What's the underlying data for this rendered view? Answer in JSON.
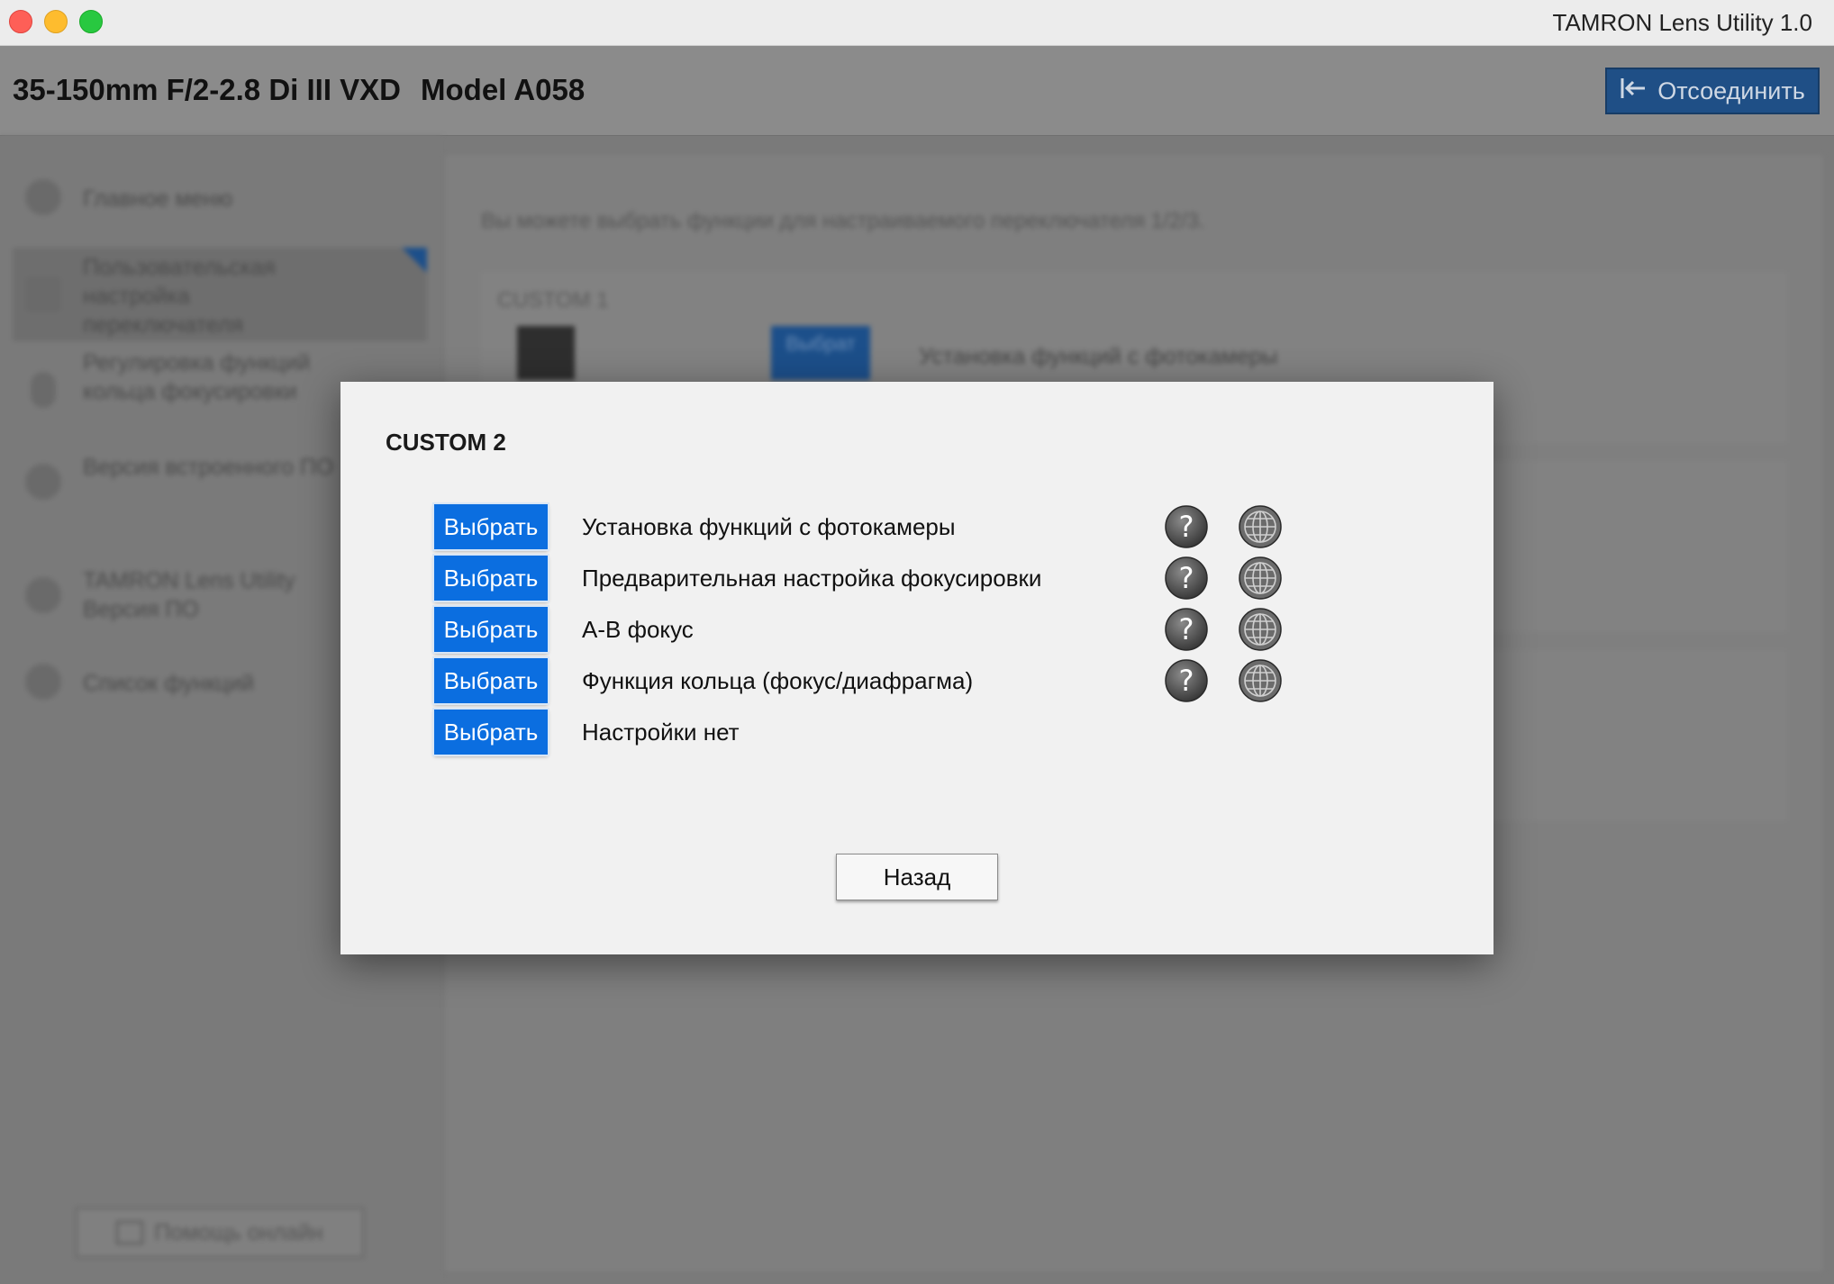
{
  "window": {
    "app_title": "TAMRON Lens Utility   1.0"
  },
  "header": {
    "lens_name": "35-150mm F/2-2.8 Di III VXD",
    "model": "Model A058",
    "disconnect_label": "Отсоединить"
  },
  "sidebar": {
    "items": [
      {
        "label": "Главное меню",
        "icon": "home-icon"
      },
      {
        "label": "Пользовательская настройка переключателя",
        "icon": "switch-icon",
        "active": true
      },
      {
        "label": "Регулировка функций кольца фокусировки",
        "icon": "ring-icon"
      },
      {
        "label": "Версия встроенного ПО",
        "icon": "firmware-icon"
      },
      {
        "label": "TAMRON Lens Utility Версия ПО",
        "icon": "info-icon"
      },
      {
        "label": "Список функций",
        "icon": "help-icon"
      }
    ],
    "online_help_label": "Помощь онлайн"
  },
  "content": {
    "note": "Вы можете выбрать функции для настраиваемого переключателя 1/2/3.",
    "cards": [
      {
        "title": "CUSTOM 1",
        "select_label": "Выбрат",
        "description": "Установка функций с фотокамеры"
      },
      {
        "title": "",
        "select_label": "",
        "description": ""
      },
      {
        "title": "",
        "select_label": "",
        "description": ""
      }
    ]
  },
  "modal": {
    "title": "CUSTOM 2",
    "options": [
      {
        "button": "Выбрать",
        "label": "Установка функций с фотокамеры",
        "has_help": true
      },
      {
        "button": "Выбрать",
        "label": "Предварительная настройка фокусировки",
        "has_help": true
      },
      {
        "button": "Выбрать",
        "label": "A-B фокус",
        "has_help": true
      },
      {
        "button": "Выбрать",
        "label": "Функция кольца (фокус/диафрагма)",
        "has_help": true
      },
      {
        "button": "Выбрать",
        "label": "Настройки нет",
        "has_help": false
      }
    ],
    "back_label": "Назад"
  },
  "colors": {
    "accent_blue": "#0b6ee0",
    "dim_overlay": "#7a7a7a",
    "modal_bg": "#f1f1f1"
  }
}
